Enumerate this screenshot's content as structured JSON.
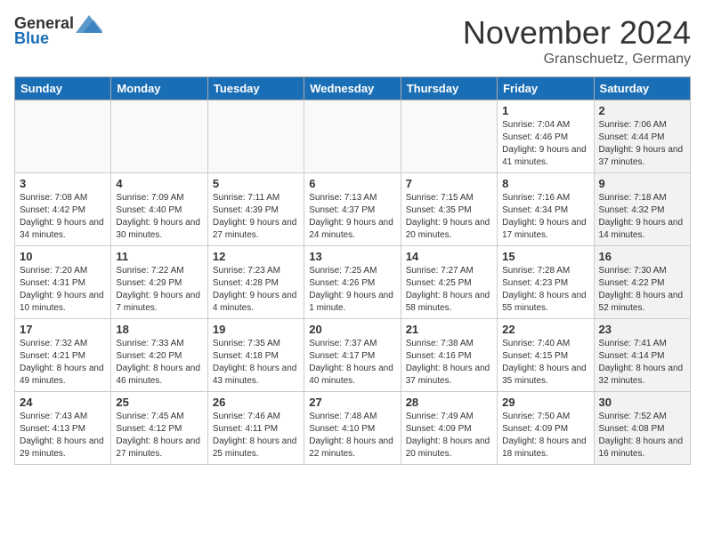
{
  "header": {
    "logo_general": "General",
    "logo_blue": "Blue",
    "month_title": "November 2024",
    "location": "Granschuetz, Germany"
  },
  "weekdays": [
    "Sunday",
    "Monday",
    "Tuesday",
    "Wednesday",
    "Thursday",
    "Friday",
    "Saturday"
  ],
  "weeks": [
    [
      {
        "day": "",
        "info": "",
        "empty": true
      },
      {
        "day": "",
        "info": "",
        "empty": true
      },
      {
        "day": "",
        "info": "",
        "empty": true
      },
      {
        "day": "",
        "info": "",
        "empty": true
      },
      {
        "day": "",
        "info": "",
        "empty": true
      },
      {
        "day": "1",
        "info": "Sunrise: 7:04 AM\nSunset: 4:46 PM\nDaylight: 9 hours and 41 minutes.",
        "empty": false
      },
      {
        "day": "2",
        "info": "Sunrise: 7:06 AM\nSunset: 4:44 PM\nDaylight: 9 hours and 37 minutes.",
        "empty": false,
        "shaded": true
      }
    ],
    [
      {
        "day": "3",
        "info": "Sunrise: 7:08 AM\nSunset: 4:42 PM\nDaylight: 9 hours and 34 minutes.",
        "empty": false
      },
      {
        "day": "4",
        "info": "Sunrise: 7:09 AM\nSunset: 4:40 PM\nDaylight: 9 hours and 30 minutes.",
        "empty": false
      },
      {
        "day": "5",
        "info": "Sunrise: 7:11 AM\nSunset: 4:39 PM\nDaylight: 9 hours and 27 minutes.",
        "empty": false
      },
      {
        "day": "6",
        "info": "Sunrise: 7:13 AM\nSunset: 4:37 PM\nDaylight: 9 hours and 24 minutes.",
        "empty": false
      },
      {
        "day": "7",
        "info": "Sunrise: 7:15 AM\nSunset: 4:35 PM\nDaylight: 9 hours and 20 minutes.",
        "empty": false
      },
      {
        "day": "8",
        "info": "Sunrise: 7:16 AM\nSunset: 4:34 PM\nDaylight: 9 hours and 17 minutes.",
        "empty": false
      },
      {
        "day": "9",
        "info": "Sunrise: 7:18 AM\nSunset: 4:32 PM\nDaylight: 9 hours and 14 minutes.",
        "empty": false,
        "shaded": true
      }
    ],
    [
      {
        "day": "10",
        "info": "Sunrise: 7:20 AM\nSunset: 4:31 PM\nDaylight: 9 hours and 10 minutes.",
        "empty": false
      },
      {
        "day": "11",
        "info": "Sunrise: 7:22 AM\nSunset: 4:29 PM\nDaylight: 9 hours and 7 minutes.",
        "empty": false
      },
      {
        "day": "12",
        "info": "Sunrise: 7:23 AM\nSunset: 4:28 PM\nDaylight: 9 hours and 4 minutes.",
        "empty": false
      },
      {
        "day": "13",
        "info": "Sunrise: 7:25 AM\nSunset: 4:26 PM\nDaylight: 9 hours and 1 minute.",
        "empty": false
      },
      {
        "day": "14",
        "info": "Sunrise: 7:27 AM\nSunset: 4:25 PM\nDaylight: 8 hours and 58 minutes.",
        "empty": false
      },
      {
        "day": "15",
        "info": "Sunrise: 7:28 AM\nSunset: 4:23 PM\nDaylight: 8 hours and 55 minutes.",
        "empty": false
      },
      {
        "day": "16",
        "info": "Sunrise: 7:30 AM\nSunset: 4:22 PM\nDaylight: 8 hours and 52 minutes.",
        "empty": false,
        "shaded": true
      }
    ],
    [
      {
        "day": "17",
        "info": "Sunrise: 7:32 AM\nSunset: 4:21 PM\nDaylight: 8 hours and 49 minutes.",
        "empty": false
      },
      {
        "day": "18",
        "info": "Sunrise: 7:33 AM\nSunset: 4:20 PM\nDaylight: 8 hours and 46 minutes.",
        "empty": false
      },
      {
        "day": "19",
        "info": "Sunrise: 7:35 AM\nSunset: 4:18 PM\nDaylight: 8 hours and 43 minutes.",
        "empty": false
      },
      {
        "day": "20",
        "info": "Sunrise: 7:37 AM\nSunset: 4:17 PM\nDaylight: 8 hours and 40 minutes.",
        "empty": false
      },
      {
        "day": "21",
        "info": "Sunrise: 7:38 AM\nSunset: 4:16 PM\nDaylight: 8 hours and 37 minutes.",
        "empty": false
      },
      {
        "day": "22",
        "info": "Sunrise: 7:40 AM\nSunset: 4:15 PM\nDaylight: 8 hours and 35 minutes.",
        "empty": false
      },
      {
        "day": "23",
        "info": "Sunrise: 7:41 AM\nSunset: 4:14 PM\nDaylight: 8 hours and 32 minutes.",
        "empty": false,
        "shaded": true
      }
    ],
    [
      {
        "day": "24",
        "info": "Sunrise: 7:43 AM\nSunset: 4:13 PM\nDaylight: 8 hours and 29 minutes.",
        "empty": false
      },
      {
        "day": "25",
        "info": "Sunrise: 7:45 AM\nSunset: 4:12 PM\nDaylight: 8 hours and 27 minutes.",
        "empty": false
      },
      {
        "day": "26",
        "info": "Sunrise: 7:46 AM\nSunset: 4:11 PM\nDaylight: 8 hours and 25 minutes.",
        "empty": false
      },
      {
        "day": "27",
        "info": "Sunrise: 7:48 AM\nSunset: 4:10 PM\nDaylight: 8 hours and 22 minutes.",
        "empty": false
      },
      {
        "day": "28",
        "info": "Sunrise: 7:49 AM\nSunset: 4:09 PM\nDaylight: 8 hours and 20 minutes.",
        "empty": false
      },
      {
        "day": "29",
        "info": "Sunrise: 7:50 AM\nSunset: 4:09 PM\nDaylight: 8 hours and 18 minutes.",
        "empty": false
      },
      {
        "day": "30",
        "info": "Sunrise: 7:52 AM\nSunset: 4:08 PM\nDaylight: 8 hours and 16 minutes.",
        "empty": false,
        "shaded": true
      }
    ]
  ]
}
